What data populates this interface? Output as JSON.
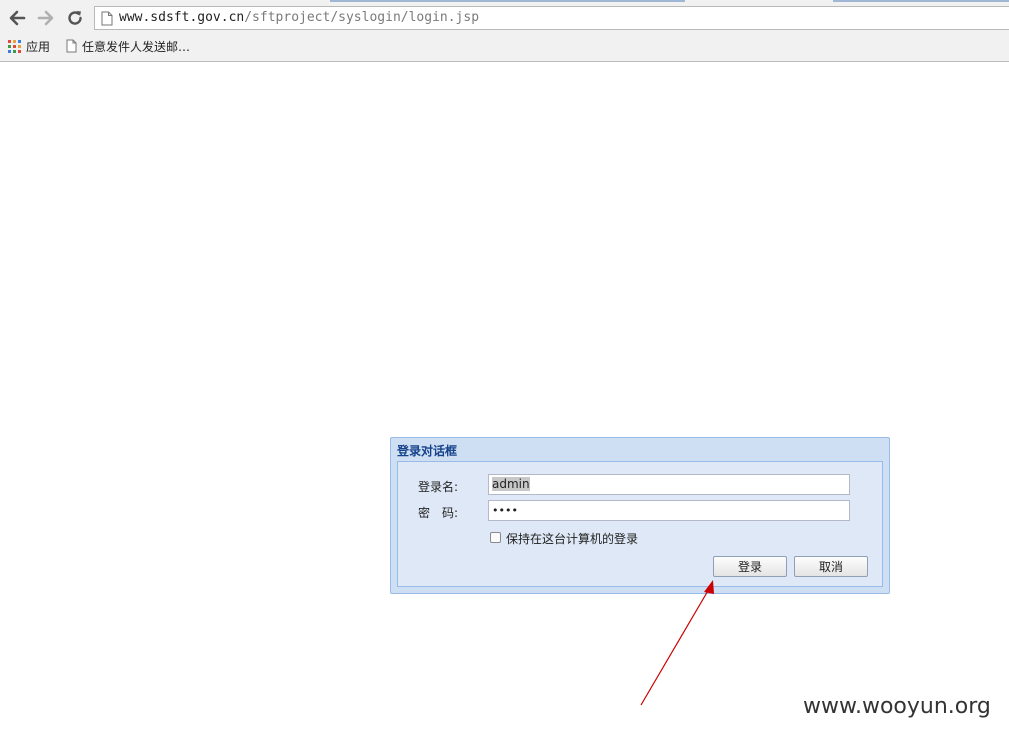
{
  "browser": {
    "address_bar": {
      "url_host": "www.sdsft.gov.cn",
      "url_path": "/sftproject/syslogin/login.jsp"
    },
    "bookmarks": [
      {
        "label": "应用",
        "icon": "apps-grid-icon"
      },
      {
        "label": "任意发件人发送邮…",
        "icon": "page-icon"
      }
    ]
  },
  "dialog": {
    "title": "登录对话框",
    "username_label": "登录名:",
    "username_value": "admin",
    "password_label": "密　码:",
    "password_value": "••••",
    "remember_label": "保持在这台计算机的登录",
    "remember_checked": false,
    "login_button": "登录",
    "cancel_button": "取消"
  },
  "annotation": {
    "arrow_color": "#cc0000"
  },
  "watermark": "www.wooyun.org",
  "colors": {
    "dialog_title": "#15428b",
    "dialog_border": "#99bbe8",
    "dialog_bg": "#dfe8f6"
  }
}
